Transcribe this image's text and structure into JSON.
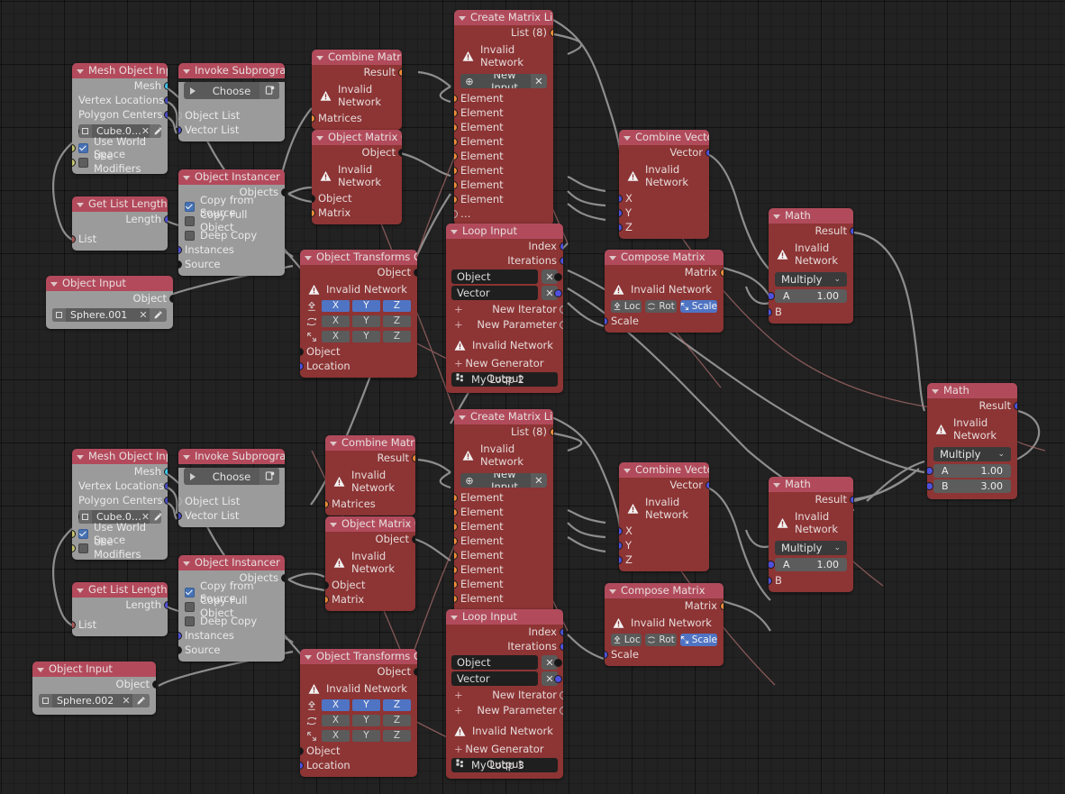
{
  "app": {
    "editor": "Blender Animation Nodes Node Editor"
  },
  "theme": {
    "background": "#222222",
    "grid_line": "#1a1a1a",
    "node_header_red": "#b14b5c",
    "node_body_grey": "#9b9b9b",
    "node_body_red": "#8d3434",
    "socket_blue": "#5050dd",
    "socket_orange": "#ee8b38",
    "socket_cyan": "#3fc3e8",
    "socket_black": "#151515",
    "socket_olive": "#c3c36f",
    "socket_brown": "#a85757",
    "toggle_active_blue": "#4f74c4",
    "link_color": "#9a9a9a"
  },
  "common": {
    "invalid_network": "Invalid Network",
    "warning_icon": "warning-triangle-icon"
  },
  "nodes": {
    "mesh_object_input_1": {
      "title": "Mesh Object Input",
      "outputs": [
        "Mesh",
        "Vertex Locations",
        "Polygon Centers"
      ],
      "object_value": "Cube.0…",
      "checkboxes": [
        {
          "label": "Use World Space",
          "checked": true
        },
        {
          "label": "Use Modifiers",
          "checked": false
        }
      ]
    },
    "invoke_subprogram_1": {
      "title": "Invoke Subprogram",
      "button": "Choose",
      "inputs": [
        "Object List",
        "Vector List"
      ]
    },
    "combine_matrices_1": {
      "title": "Combine Matrices",
      "output": "Result",
      "input": "Matrices"
    },
    "create_matrix_list_1": {
      "title": "Create Matrix List",
      "output": "List (8)",
      "new_input": "New Input",
      "elements": [
        "Element",
        "Element",
        "Element",
        "Element",
        "Element",
        "Element",
        "Element",
        "Element"
      ],
      "more": "…"
    },
    "combine_vector_1": {
      "title": "Combine Vector",
      "output": "Vector",
      "inputs": [
        "X",
        "Y",
        "Z"
      ]
    },
    "math_1": {
      "title": "Math",
      "output": "Result",
      "operation": "Multiply",
      "a_label": "A",
      "a_value": "1.00",
      "b_label": "B",
      "b_value": ""
    },
    "object_matrix_output_1": {
      "title": "Object Matrix Output",
      "output": "Object",
      "inputs": [
        "Object",
        "Matrix"
      ]
    },
    "object_instancer_1": {
      "title": "Object Instancer",
      "output": "Objects",
      "checkboxes": [
        {
          "label": "Copy from Source",
          "checked": true
        },
        {
          "label": "Copy Full Object",
          "checked": false
        },
        {
          "label": "Deep Copy",
          "checked": false
        }
      ],
      "inputs": [
        "Instances",
        "Source"
      ]
    },
    "get_list_length_1": {
      "title": "Get List Length",
      "output": "Length",
      "input": "List"
    },
    "object_input_1": {
      "title": "Object Input",
      "output": "Object",
      "object_value": "Sphere.001"
    },
    "object_transforms_output_1": {
      "title": "Object Transforms Output",
      "output": "Object",
      "rows": [
        {
          "icon": "location-arrow-icon",
          "cells": [
            "X",
            "Y",
            "Z"
          ],
          "active": [
            true,
            true,
            true
          ]
        },
        {
          "icon": "rotation-icon",
          "cells": [
            "X",
            "Y",
            "Z"
          ],
          "active": [
            false,
            false,
            false
          ]
        },
        {
          "icon": "scale-icon",
          "cells": [
            "X",
            "Y",
            "Z"
          ],
          "active": [
            false,
            false,
            false
          ]
        }
      ],
      "inputs": [
        "Object",
        "Location"
      ]
    },
    "loop_input_1": {
      "title": "Loop Input",
      "outputs": [
        "Index",
        "Iterations"
      ],
      "params": [
        "Object",
        "Vector"
      ],
      "new_iterator": "New Iterator",
      "new_parameter": "New Parameter",
      "new_generator_output": "New Generator Output",
      "loop_name": "My Loop 2"
    },
    "compose_matrix_1": {
      "title": "Compose Matrix",
      "output": "Matrix",
      "toggles": [
        {
          "label": "Loc",
          "icon": "location-arrow-icon",
          "active": false
        },
        {
          "label": "Rot",
          "icon": "rotation-icon",
          "active": false
        },
        {
          "label": "Scale",
          "icon": "scale-icon",
          "active": true
        }
      ],
      "input": "Scale"
    },
    "math_right": {
      "title": "Math",
      "output": "Result",
      "operation": "Multiply",
      "a_label": "A",
      "a_value": "1.00",
      "b_label": "B",
      "b_value": "3.00"
    },
    "mesh_object_input_2": {
      "title": "Mesh Object Input",
      "outputs": [
        "Mesh",
        "Vertex Locations",
        "Polygon Centers"
      ],
      "object_value": "Cube.0…",
      "checkboxes": [
        {
          "label": "Use World Space",
          "checked": true
        },
        {
          "label": "Use Modifiers",
          "checked": false
        }
      ]
    },
    "invoke_subprogram_2": {
      "title": "Invoke Subprogram",
      "button": "Choose",
      "inputs": [
        "Object List",
        "Vector List"
      ]
    },
    "combine_matrices_2": {
      "title": "Combine Matrices",
      "output": "Result",
      "input": "Matrices"
    },
    "create_matrix_list_2": {
      "title": "Create Matrix List",
      "output": "List (8)",
      "new_input": "New Input",
      "elements": [
        "Element",
        "Element",
        "Element",
        "Element",
        "Element",
        "Element",
        "Element",
        "Element"
      ],
      "more": "…"
    },
    "combine_vector_2": {
      "title": "Combine Vector",
      "output": "Vector",
      "inputs": [
        "X",
        "Y",
        "Z"
      ]
    },
    "math_2": {
      "title": "Math",
      "output": "Result",
      "operation": "Multiply",
      "a_label": "A",
      "a_value": "1.00",
      "b_label": "B",
      "b_value": ""
    },
    "object_matrix_output_2": {
      "title": "Object Matrix Output",
      "output": "Object",
      "inputs": [
        "Object",
        "Matrix"
      ]
    },
    "object_instancer_2": {
      "title": "Object Instancer",
      "output": "Objects",
      "checkboxes": [
        {
          "label": "Copy from Source",
          "checked": true
        },
        {
          "label": "Copy Full Object",
          "checked": false
        },
        {
          "label": "Deep Copy",
          "checked": false
        }
      ],
      "inputs": [
        "Instances",
        "Source"
      ]
    },
    "get_list_length_2": {
      "title": "Get List Length",
      "output": "Length",
      "input": "List"
    },
    "object_input_2": {
      "title": "Object Input",
      "output": "Object",
      "object_value": "Sphere.002"
    },
    "object_transforms_output_2": {
      "title": "Object Transforms Output",
      "output": "Object",
      "rows": [
        {
          "icon": "location-arrow-icon",
          "cells": [
            "X",
            "Y",
            "Z"
          ],
          "active": [
            true,
            true,
            true
          ]
        },
        {
          "icon": "rotation-icon",
          "cells": [
            "X",
            "Y",
            "Z"
          ],
          "active": [
            false,
            false,
            false
          ]
        },
        {
          "icon": "scale-icon",
          "cells": [
            "X",
            "Y",
            "Z"
          ],
          "active": [
            false,
            false,
            false
          ]
        }
      ],
      "inputs": [
        "Object",
        "Location"
      ]
    },
    "loop_input_2": {
      "title": "Loop Input",
      "outputs": [
        "Index",
        "Iterations"
      ],
      "params": [
        "Object",
        "Vector"
      ],
      "new_iterator": "New Iterator",
      "new_parameter": "New Parameter",
      "new_generator_output": "New Generator Output",
      "loop_name": "My Loop 3"
    },
    "compose_matrix_2": {
      "title": "Compose Matrix",
      "output": "Matrix",
      "toggles": [
        {
          "label": "Loc",
          "icon": "location-arrow-icon",
          "active": false
        },
        {
          "label": "Rot",
          "icon": "rotation-icon",
          "active": false
        },
        {
          "label": "Scale",
          "icon": "scale-icon",
          "active": true
        }
      ],
      "input": "Scale"
    }
  }
}
